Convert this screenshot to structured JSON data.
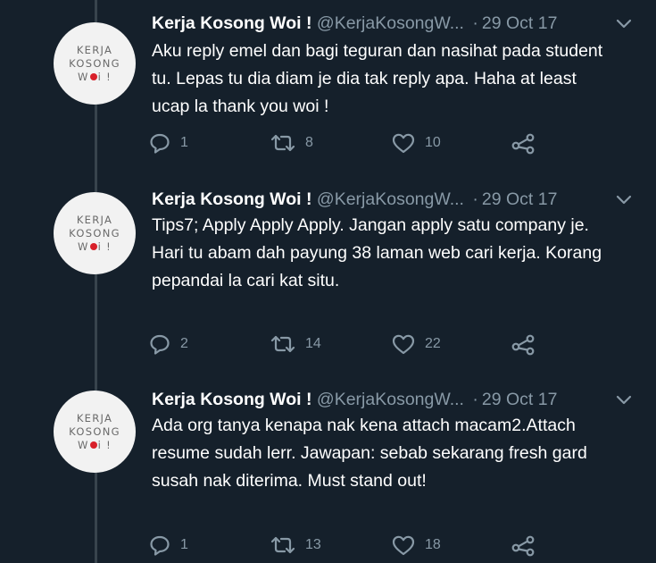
{
  "tweets": [
    {
      "avatar": {
        "line1": "KERJA",
        "line2": "KOSONG",
        "line3_left": "W",
        "line3_right": "i !"
      },
      "name": "Kerja Kosong Woi !",
      "handle": "@KerjaKosongW...",
      "separator": "·",
      "date": "29 Oct 17",
      "text": "Aku reply emel dan bagi teguran dan nasihat pada student tu. Lepas tu dia diam je dia tak reply apa. Haha at least ucap la thank you woi !",
      "replies": "1",
      "retweets": "8",
      "likes": "10"
    },
    {
      "avatar": {
        "line1": "KERJA",
        "line2": "KOSONG",
        "line3_left": "W",
        "line3_right": "i !"
      },
      "name": "Kerja Kosong Woi !",
      "handle": "@KerjaKosongW...",
      "separator": "·",
      "date": "29 Oct 17",
      "text": "Tips7; Apply Apply Apply. Jangan apply satu company je. Hari tu abam dah payung 38 laman web cari kerja. Korang pepandai la cari kat situ.",
      "replies": "2",
      "retweets": "14",
      "likes": "22"
    },
    {
      "avatar": {
        "line1": "KERJA",
        "line2": "KOSONG",
        "line3_left": "W",
        "line3_right": "i !"
      },
      "name": "Kerja Kosong Woi !",
      "handle": "@KerjaKosongW...",
      "separator": "·",
      "date": "29 Oct 17",
      "text": "Ada org tanya kenapa nak kena attach macam2.Attach resume sudah lerr. Jawapan: sebab sekarang fresh gard susah nak diterima. Must stand out!",
      "replies": "1",
      "retweets": "13",
      "likes": "18"
    }
  ],
  "icons": [
    "reply-icon",
    "retweet-icon",
    "like-icon",
    "share-icon",
    "chevron-down-icon"
  ],
  "colors": {
    "background": "#15202b",
    "text": "#ffffff",
    "muted": "#8899a6",
    "thread_line": "#38444d",
    "avatar_bg": "#f2f2f2",
    "avatar_dot": "#d8202a"
  }
}
